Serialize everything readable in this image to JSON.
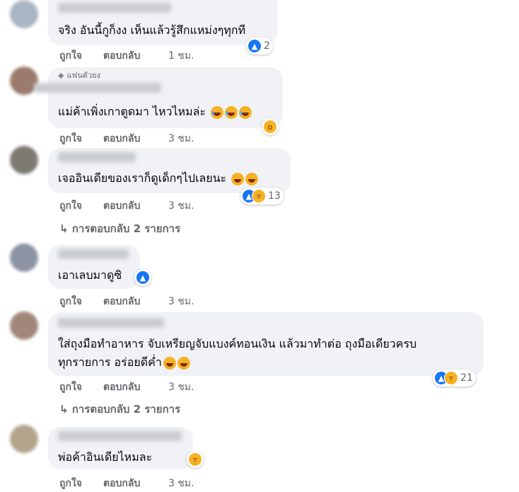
{
  "labels": {
    "like": "ถูกใจ",
    "reply": "ตอบกลับ"
  },
  "comments": [
    {
      "text": "จริง อันนี้กูก็งง เห็นแล้วรู้สึกแหม่งๆทุกที",
      "time": "1 ชม.",
      "reaction_count": "2"
    },
    {
      "badge": "แฟนตัวยง",
      "text": "แม่ค้าเพิ่งเกาตูดมา ไหวไหมล่ะ",
      "time": "3 ชม."
    },
    {
      "text": "เจออินเดียของเราก็ดูเด็กๆไปเลยนะ",
      "time": "3 ชม.",
      "reaction_count": "13",
      "replies": "การตอบกลับ 2 รายการ"
    },
    {
      "text": "เอาเลบมาดูซิ",
      "time": "3 ชม."
    },
    {
      "text": "ใส่ถุงมือทำอาหาร จับเหรียญจับแบงค์ทอนเงิน แล้วมาทำต่อ ถุงมือเดียวครบ",
      "text2": "ทุกรายการ อร่อยดีค่ำ",
      "time": "3 ชม.",
      "reaction_count": "21",
      "replies": "การตอบกลับ 2 รายการ"
    },
    {
      "text": "พ่อค้าอินเดียไหมละ",
      "time": "3 ชม."
    }
  ],
  "icons": {
    "reply_arrow": "↳",
    "like_icon": "👍",
    "badge_icon": "◈"
  },
  "colors": {
    "like_blue": "#1877f2",
    "bubble": "#f0f2f5",
    "meta": "#65676b"
  }
}
